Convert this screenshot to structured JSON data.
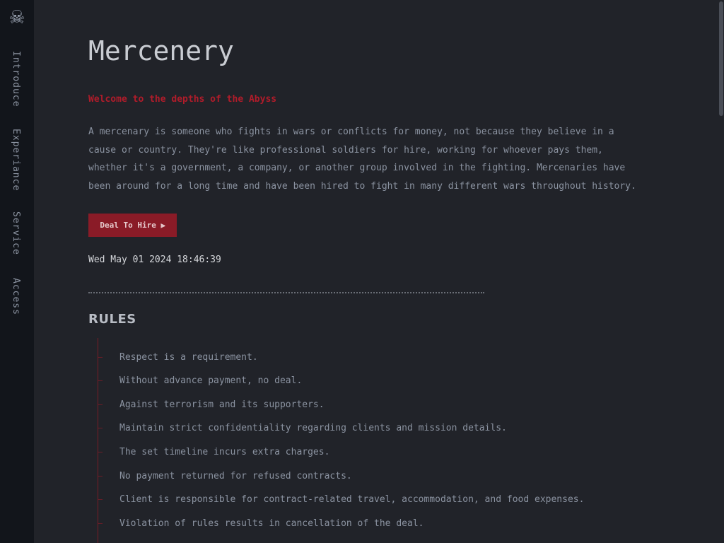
{
  "sidebar": {
    "logo_icon": "skull-and-crossbones-icon",
    "logo_glyph": "☠",
    "nav": [
      "Introduce",
      "Experiance",
      "Service",
      "Access"
    ]
  },
  "main": {
    "title": "Mercenery",
    "tagline": "Welcome to the depths of the Abyss",
    "intro": "A mercenary is someone who fights in wars or conflicts for money, not because they believe in a cause or country. They're like professional soldiers for hire, working for whoever pays them, whether it's a government, a company, or another group involved in the fighting. Mercenaries have been around for a long time and have been hired to fight in many different wars throughout history.",
    "hire_button": "Deal To Hire ⫸",
    "datetime": "Wed May 01 2024 18:46:39",
    "rules_title": "RULES",
    "rules": [
      "Respect is a requirement.",
      "Without advance payment, no deal.",
      "Against terrorism and its supporters.",
      "Maintain strict confidentiality regarding clients and mission details.",
      "The set timeline incurs extra charges.",
      "No payment returned for refused contracts.",
      "Client is responsible for contract-related travel, accommodation, and food expenses.",
      "Violation of rules results in cancellation of the deal."
    ]
  },
  "colors": {
    "background": "#212329",
    "sidebar": "#12151b",
    "accent_red": "#b01c2a",
    "button": "#8a1b27",
    "text": "#8b93a1"
  }
}
